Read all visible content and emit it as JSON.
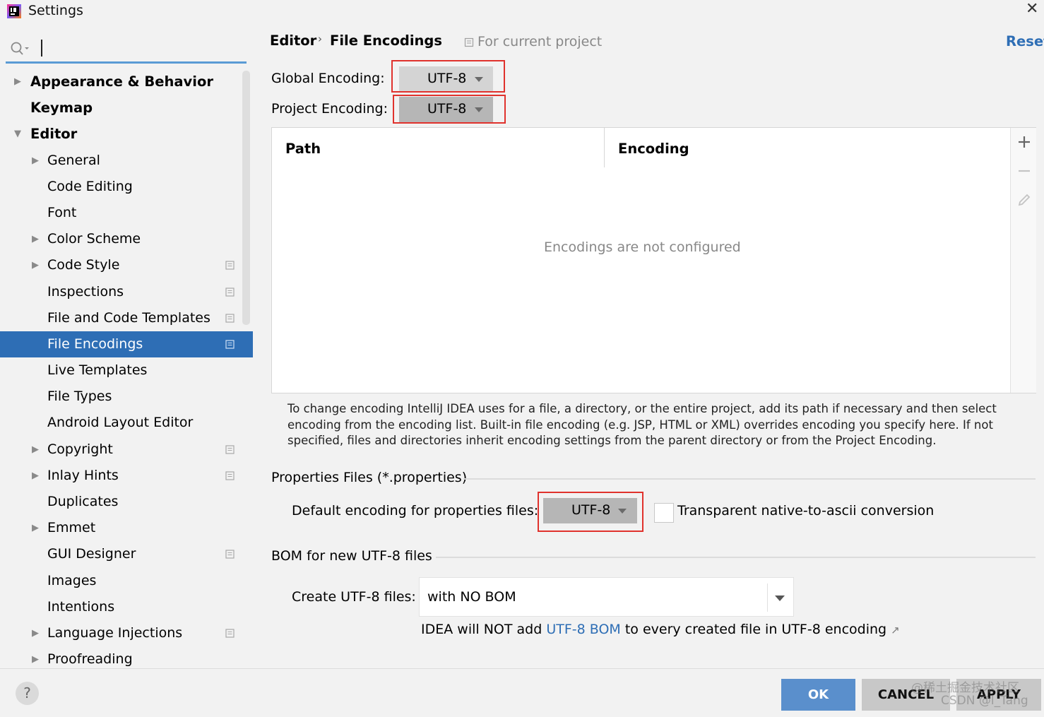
{
  "window": {
    "title": "Settings",
    "close_glyph": "✕"
  },
  "sidebar": {
    "items": [
      {
        "label": "Appearance & Behavior",
        "level": 0,
        "arrow": "collapsed",
        "project": false
      },
      {
        "label": "Keymap",
        "level": 0,
        "arrow": "none",
        "project": false
      },
      {
        "label": "Editor",
        "level": 0,
        "arrow": "expanded",
        "project": false
      },
      {
        "label": "General",
        "level": 1,
        "arrow": "collapsed",
        "project": false
      },
      {
        "label": "Code Editing",
        "level": 1,
        "arrow": "none",
        "project": false
      },
      {
        "label": "Font",
        "level": 1,
        "arrow": "none",
        "project": false
      },
      {
        "label": "Color Scheme",
        "level": 1,
        "arrow": "collapsed",
        "project": false
      },
      {
        "label": "Code Style",
        "level": 1,
        "arrow": "collapsed",
        "project": true
      },
      {
        "label": "Inspections",
        "level": 1,
        "arrow": "none",
        "project": true
      },
      {
        "label": "File and Code Templates",
        "level": 1,
        "arrow": "none",
        "project": true
      },
      {
        "label": "File Encodings",
        "level": 1,
        "arrow": "none",
        "project": true,
        "selected": true
      },
      {
        "label": "Live Templates",
        "level": 1,
        "arrow": "none",
        "project": false
      },
      {
        "label": "File Types",
        "level": 1,
        "arrow": "none",
        "project": false
      },
      {
        "label": "Android Layout Editor",
        "level": 1,
        "arrow": "none",
        "project": false
      },
      {
        "label": "Copyright",
        "level": 1,
        "arrow": "collapsed",
        "project": true
      },
      {
        "label": "Inlay Hints",
        "level": 1,
        "arrow": "collapsed",
        "project": true
      },
      {
        "label": "Duplicates",
        "level": 1,
        "arrow": "none",
        "project": false
      },
      {
        "label": "Emmet",
        "level": 1,
        "arrow": "collapsed",
        "project": false
      },
      {
        "label": "GUI Designer",
        "level": 1,
        "arrow": "none",
        "project": true
      },
      {
        "label": "Images",
        "level": 1,
        "arrow": "none",
        "project": false
      },
      {
        "label": "Intentions",
        "level": 1,
        "arrow": "none",
        "project": false
      },
      {
        "label": "Language Injections",
        "level": 1,
        "arrow": "collapsed",
        "project": true
      },
      {
        "label": "Proofreading",
        "level": 1,
        "arrow": "collapsed",
        "project": false
      }
    ]
  },
  "header": {
    "breadcrumb_parent": "Editor",
    "breadcrumb_sep": "›",
    "breadcrumb_current": "File Encodings",
    "scope": "For current project",
    "reset": "Reset"
  },
  "encodings": {
    "global_label": "Global Encoding:",
    "global_value": "UTF-8",
    "project_label": "Project Encoding:",
    "project_value": "UTF-8"
  },
  "table": {
    "col_path": "Path",
    "col_encoding": "Encoding",
    "empty_text": "Encodings are not configured",
    "tools": [
      "add-icon",
      "remove-icon",
      "edit-icon"
    ]
  },
  "help_text": "To change encoding IntelliJ IDEA uses for a file, a directory, or the entire project, add its path if necessary and then select encoding from the encoding list. Built-in file encoding (e.g. JSP, HTML or XML) overrides encoding you specify here. If not specified, files and directories inherit encoding settings from the parent directory or from the Project Encoding.",
  "properties": {
    "section_title": "Properties Files (*.properties)",
    "default_label": "Default encoding for properties files:",
    "default_value": "UTF-8",
    "transparent_label": "Transparent native-to-ascii conversion",
    "transparent_checked": false
  },
  "bom": {
    "section_title": "BOM for new UTF-8 files",
    "create_label": "Create UTF-8 files:",
    "create_value": "with NO BOM",
    "note_prefix": "IDEA will NOT add ",
    "note_link": "UTF-8 BOM",
    "note_suffix": " to every created file in UTF-8 encoding",
    "note_ext": "↗"
  },
  "footer": {
    "help": "?",
    "ok": "OK",
    "cancel": "CANCEL",
    "apply": "APPLY",
    "watermark_line1": "@稀土掘金技术社区",
    "watermark_line2": "CSDN @l_Tang"
  },
  "colors": {
    "accent": "#2e6eb5",
    "highlight_box": "#e0322d",
    "ok_button": "#5a8fcc"
  }
}
